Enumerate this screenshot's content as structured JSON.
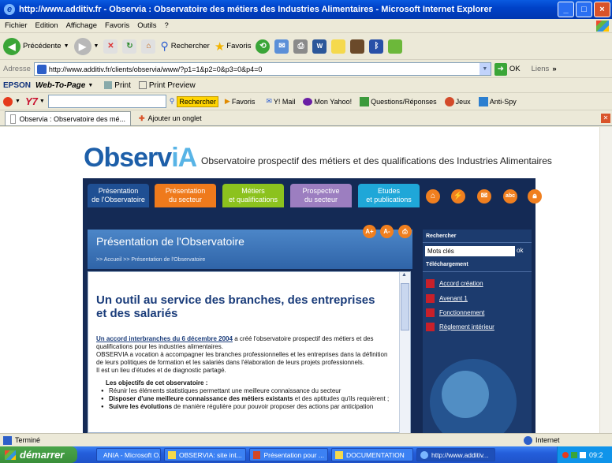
{
  "window": {
    "title": "http://www.additiv.fr - Observia : Observatoire des métiers des Industries Alimentaires - Microsoft Internet Explorer"
  },
  "menu": [
    "Fichier",
    "Edition",
    "Affichage",
    "Favoris",
    "Outils",
    "?"
  ],
  "toolbar": {
    "back": "Précédente",
    "search": "Rechercher",
    "favorites": "Favoris"
  },
  "address": {
    "label": "Adresse",
    "url": "http://www.additiv.fr/clients/observia/www/?p1=1&p2=0&p3=0&p4=0",
    "go": "OK",
    "links": "Liens"
  },
  "epson": {
    "brand": "EPSON",
    "webtopage": "Web-To-Page",
    "print": "Print",
    "preview": "Print Preview"
  },
  "yahoo": {
    "search_btn": "Rechercher",
    "favoris": "Favoris",
    "mail": "Y! Mail",
    "myyahoo": "Mon Yahoo!",
    "qa": "Questions/Réponses",
    "jeux": "Jeux",
    "antispy": "Anti-Spy"
  },
  "tabs": {
    "active": "Observia : Observatoire des mé...",
    "add": "Ajouter un onglet"
  },
  "site": {
    "logo_a": "Observ",
    "logo_b": "iA",
    "tagline": "Observatoire prospectif des métiers et des qualifications des Industries Alimentaires",
    "nav": [
      {
        "l1": "Présentation",
        "l2": "de l'Observatoire"
      },
      {
        "l1": "Présentation",
        "l2": "du secteur"
      },
      {
        "l1": "Métiers",
        "l2": "et qualifications"
      },
      {
        "l1": "Prospective",
        "l2": "du secteur"
      },
      {
        "l1": "Etudes",
        "l2": "et publications"
      }
    ],
    "page_title": "Présentation de l'Observatoire",
    "breadcrumb": ">> Accueil >> Présentation de l'Observatoire",
    "font_buttons": [
      "A+",
      "A-"
    ],
    "headline": "Un outil au service des branches, des entreprises et des salariés",
    "link_text": "Un accord interbranches du 6 décembre 2004",
    "p1_rest": " a créé l'observatoire prospectif des métiers et des qualifications pour les industries alimentaires.",
    "p2": "OBSERVIA a vocation à accompagner les branches professionnelles et les entreprises dans la définition de leurs politiques de formation et les salariés dans l'élaboration de leurs projets professionnels.",
    "p3": "Il est un lieu d'études et de diagnostic partagé.",
    "objectives_title": "Les objectifs de cet observatoire :",
    "obj1": "Réunir les éléments statistiques permettant une meilleure connaissance du secteur",
    "obj2_bold": "Disposer d'une meilleure connaissance des métiers existants",
    "obj2_rest": " et des aptitudes qu'ils requièrent ;",
    "obj3_bold": "Suivre les évolutions",
    "obj3_rest": " de manière régulière pour pouvoir proposer des actions par anticipation",
    "search_label": "Rechercher",
    "search_placeholder": "Mots clés",
    "ok": "ok",
    "downloads_label": "Téléchargement",
    "downloads": [
      "Accord création",
      "Avenant 1",
      "Fonctionnement",
      "Règlement intérieur"
    ]
  },
  "status": {
    "left": "Terminé",
    "zone": "Internet"
  },
  "taskbar": {
    "start": "démarrer",
    "items": [
      "ANIA - Microsoft O...",
      "OBSERVIA: site int...",
      "Présentation pour ...",
      "DOCUMENTATION",
      "http://www.additiv..."
    ],
    "clock": "09:2"
  }
}
